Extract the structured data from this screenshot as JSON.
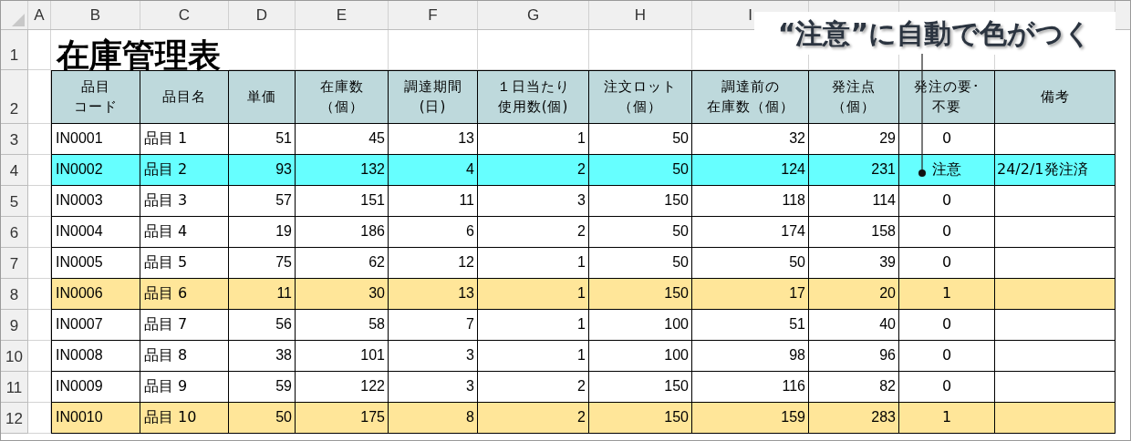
{
  "column_letters": [
    "A",
    "B",
    "C",
    "D",
    "E",
    "F",
    "G",
    "H",
    "I"
  ],
  "row_numbers": [
    "1",
    "2",
    "3",
    "4",
    "5",
    "6",
    "7",
    "8",
    "9",
    "10",
    "11",
    "12"
  ],
  "title": "在庫管理表",
  "headers": [
    [
      "品目",
      "コード"
    ],
    [
      "品目名"
    ],
    [
      "単価"
    ],
    [
      "在庫数",
      "（個）"
    ],
    [
      "調達期間",
      "(日)"
    ],
    [
      "１日当たり",
      "使用数(個)"
    ],
    [
      "注文ロット",
      "（個）"
    ],
    [
      "調達前の",
      "在庫数（個）"
    ],
    [
      "発注点",
      "（個）"
    ],
    [
      "発注の要･",
      "不要"
    ],
    [
      "備考"
    ]
  ],
  "rows": [
    {
      "color": "#ffffff",
      "cells": [
        "IN0001",
        "品目 1",
        "51",
        "45",
        "13",
        "1",
        "50",
        "32",
        "29",
        "0"
      ]
    },
    {
      "color": "#66ffff",
      "cells": [
        "IN0002",
        "品目 2",
        "93",
        "132",
        "4",
        "2",
        "50",
        "124",
        "231",
        "注意"
      ],
      "remark": "24/2/1発注済"
    },
    {
      "color": "#ffffff",
      "cells": [
        "IN0003",
        "品目 3",
        "57",
        "151",
        "11",
        "3",
        "150",
        "118",
        "114",
        "0"
      ]
    },
    {
      "color": "#ffffff",
      "cells": [
        "IN0004",
        "品目 4",
        "19",
        "186",
        "6",
        "2",
        "50",
        "174",
        "158",
        "0"
      ]
    },
    {
      "color": "#ffffff",
      "cells": [
        "IN0005",
        "品目 5",
        "75",
        "62",
        "12",
        "1",
        "50",
        "50",
        "39",
        "0"
      ]
    },
    {
      "color": "#ffe699",
      "cells": [
        "IN0006",
        "品目 6",
        "11",
        "30",
        "13",
        "1",
        "150",
        "17",
        "20",
        "1"
      ]
    },
    {
      "color": "#ffffff",
      "cells": [
        "IN0007",
        "品目 7",
        "56",
        "58",
        "7",
        "1",
        "100",
        "51",
        "40",
        "0"
      ]
    },
    {
      "color": "#ffffff",
      "cells": [
        "IN0008",
        "品目 8",
        "38",
        "101",
        "3",
        "1",
        "100",
        "98",
        "96",
        "0"
      ]
    },
    {
      "color": "#ffffff",
      "cells": [
        "IN0009",
        "品目 9",
        "59",
        "122",
        "3",
        "2",
        "150",
        "116",
        "82",
        "0"
      ]
    },
    {
      "color": "#ffe699",
      "cells": [
        "IN0010",
        "品目 10",
        "50",
        "175",
        "8",
        "2",
        "150",
        "159",
        "283",
        "1"
      ]
    }
  ],
  "callout": {
    "text": "“注意”に自動で色がつく"
  }
}
